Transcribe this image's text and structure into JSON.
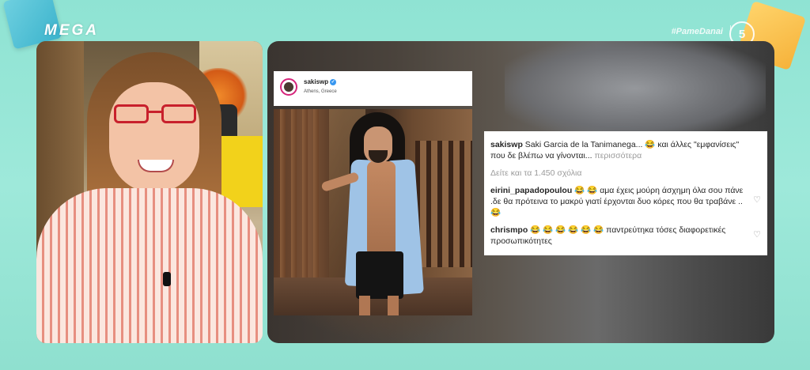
{
  "broadcast": {
    "channel_logo": "MEGA",
    "hashtag": "#PameDanai",
    "channel_badge": "5"
  },
  "post": {
    "username": "sakiswp",
    "location": "Athens, Greece",
    "caption": {
      "user": "sakiswp",
      "text_1": "Saki Garcia de la Tanimanega...",
      "emoji_1": "😂",
      "text_2": "και άλλες \"εμφανίσεις\" που δε βλέπω να γίνονται...",
      "more": "περισσότερα"
    },
    "view_all": "Δείτε και τα 1.450 σχόλια",
    "comments": [
      {
        "user": "eirini_papadopoulou",
        "emoji_a": "😂 😂",
        "text_a": "αμα έχεις μούρη άσχημη όλα σου πάνε .δε θα πρότεινα  το μακρύ  γιατί έρχονται δυο κόρες που θα τραβάνε ..",
        "emoji_b": "😂"
      },
      {
        "user": "chrismpo",
        "emoji_a": "😂 😂 😂 😂 😂 😂",
        "text_a": "παντρεύτηκα τόσες διαφορετικές προσωπικότητες"
      }
    ]
  },
  "icons": {
    "heart": "heart-icon",
    "verified": "verified-badge-icon"
  },
  "colors": {
    "background": "#9ee9da",
    "instagram_verified": "#3897f0",
    "muted_text": "#9a9a9a"
  }
}
